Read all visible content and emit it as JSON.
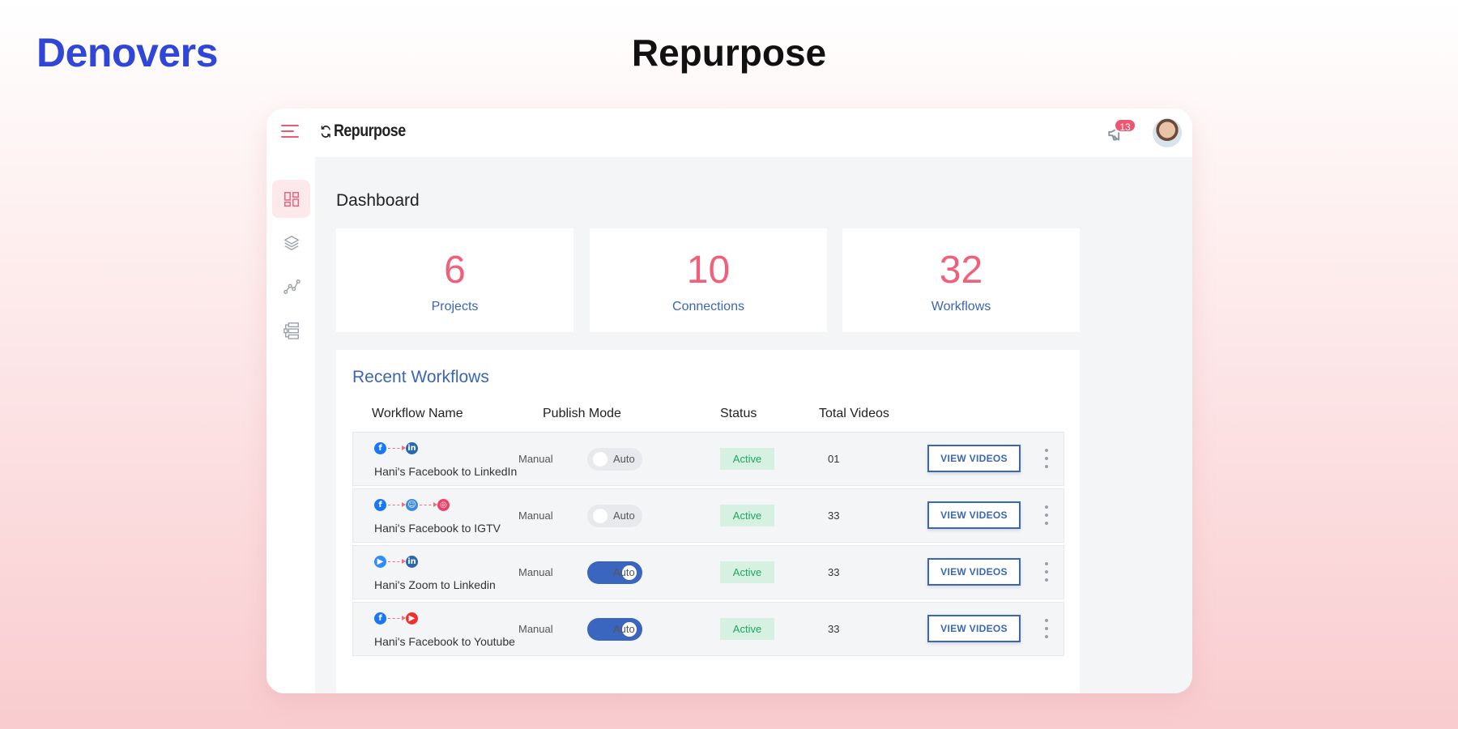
{
  "brand": "Denovers",
  "page_title": "Repurpose",
  "app": {
    "logo_text": "Repurpose",
    "notifications_count": "13"
  },
  "dashboard": {
    "title": "Dashboard",
    "stats": [
      {
        "value": "6",
        "label": "Projects"
      },
      {
        "value": "10",
        "label": "Connections"
      },
      {
        "value": "32",
        "label": "Workflows"
      }
    ]
  },
  "recent": {
    "title": "Recent Workflows",
    "columns": [
      "Workflow Name",
      "Publish Mode",
      "Status",
      "Total Videos"
    ],
    "mode_manual": "Manual",
    "mode_auto": "Auto",
    "view_label": "VIEW VIDEOS",
    "rows": [
      {
        "name": "Hani's Facebook to LinkedIn",
        "status": "Active",
        "videos": "01",
        "auto": false,
        "flow": [
          "facebook",
          "linkedin"
        ]
      },
      {
        "name": "Hani's Facebook to IGTV",
        "status": "Active",
        "videos": "33",
        "auto": false,
        "flow": [
          "facebook",
          "igtv",
          "instagram"
        ]
      },
      {
        "name": "Hani's Zoom to Linkedin",
        "status": "Active",
        "videos": "33",
        "auto": true,
        "flow": [
          "zoom",
          "linkedin"
        ]
      },
      {
        "name": "Hani's Facebook to Youtube",
        "status": "Active",
        "videos": "33",
        "auto": true,
        "flow": [
          "facebook",
          "youtube"
        ]
      }
    ]
  },
  "colors": {
    "brand": "#2f46d6",
    "accent": "#f0607a",
    "link_blue": "#3a66b4",
    "active_green": "#1fa463"
  }
}
